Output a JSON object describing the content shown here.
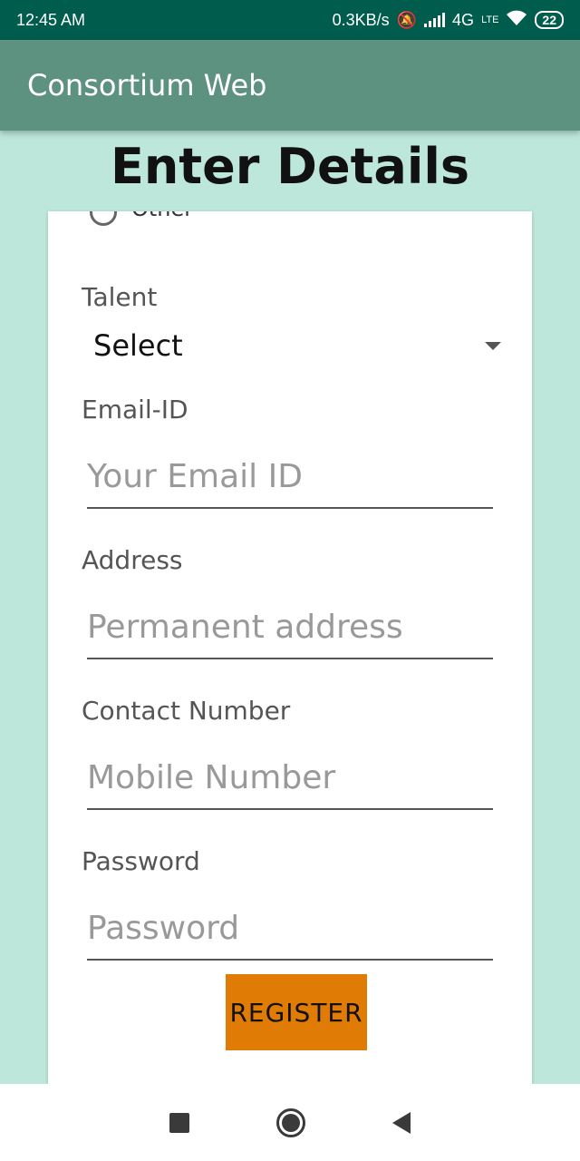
{
  "status_bar": {
    "time": "12:45 AM",
    "speed": "0.3KB/s",
    "network": "4G",
    "volte": "LTE",
    "battery": "22"
  },
  "app_bar": {
    "title": "Consortium Web"
  },
  "page": {
    "heading": "Enter Details"
  },
  "form": {
    "radio_partial_label": "Other",
    "talent": {
      "label": "Talent",
      "selected": "Select"
    },
    "email": {
      "label": "Email-ID",
      "placeholder": "Your Email ID",
      "value": ""
    },
    "address": {
      "label": "Address",
      "placeholder": "Permanent address",
      "value": ""
    },
    "contact": {
      "label": "Contact Number",
      "placeholder": "Mobile Number",
      "value": ""
    },
    "password": {
      "label": "Password",
      "placeholder": "Password",
      "value": ""
    },
    "register_label": "REGISTER"
  },
  "colors": {
    "status_bar": "#005c4c",
    "app_bar": "#5e9280",
    "background": "#bde7da",
    "register_button": "#e07c06"
  }
}
